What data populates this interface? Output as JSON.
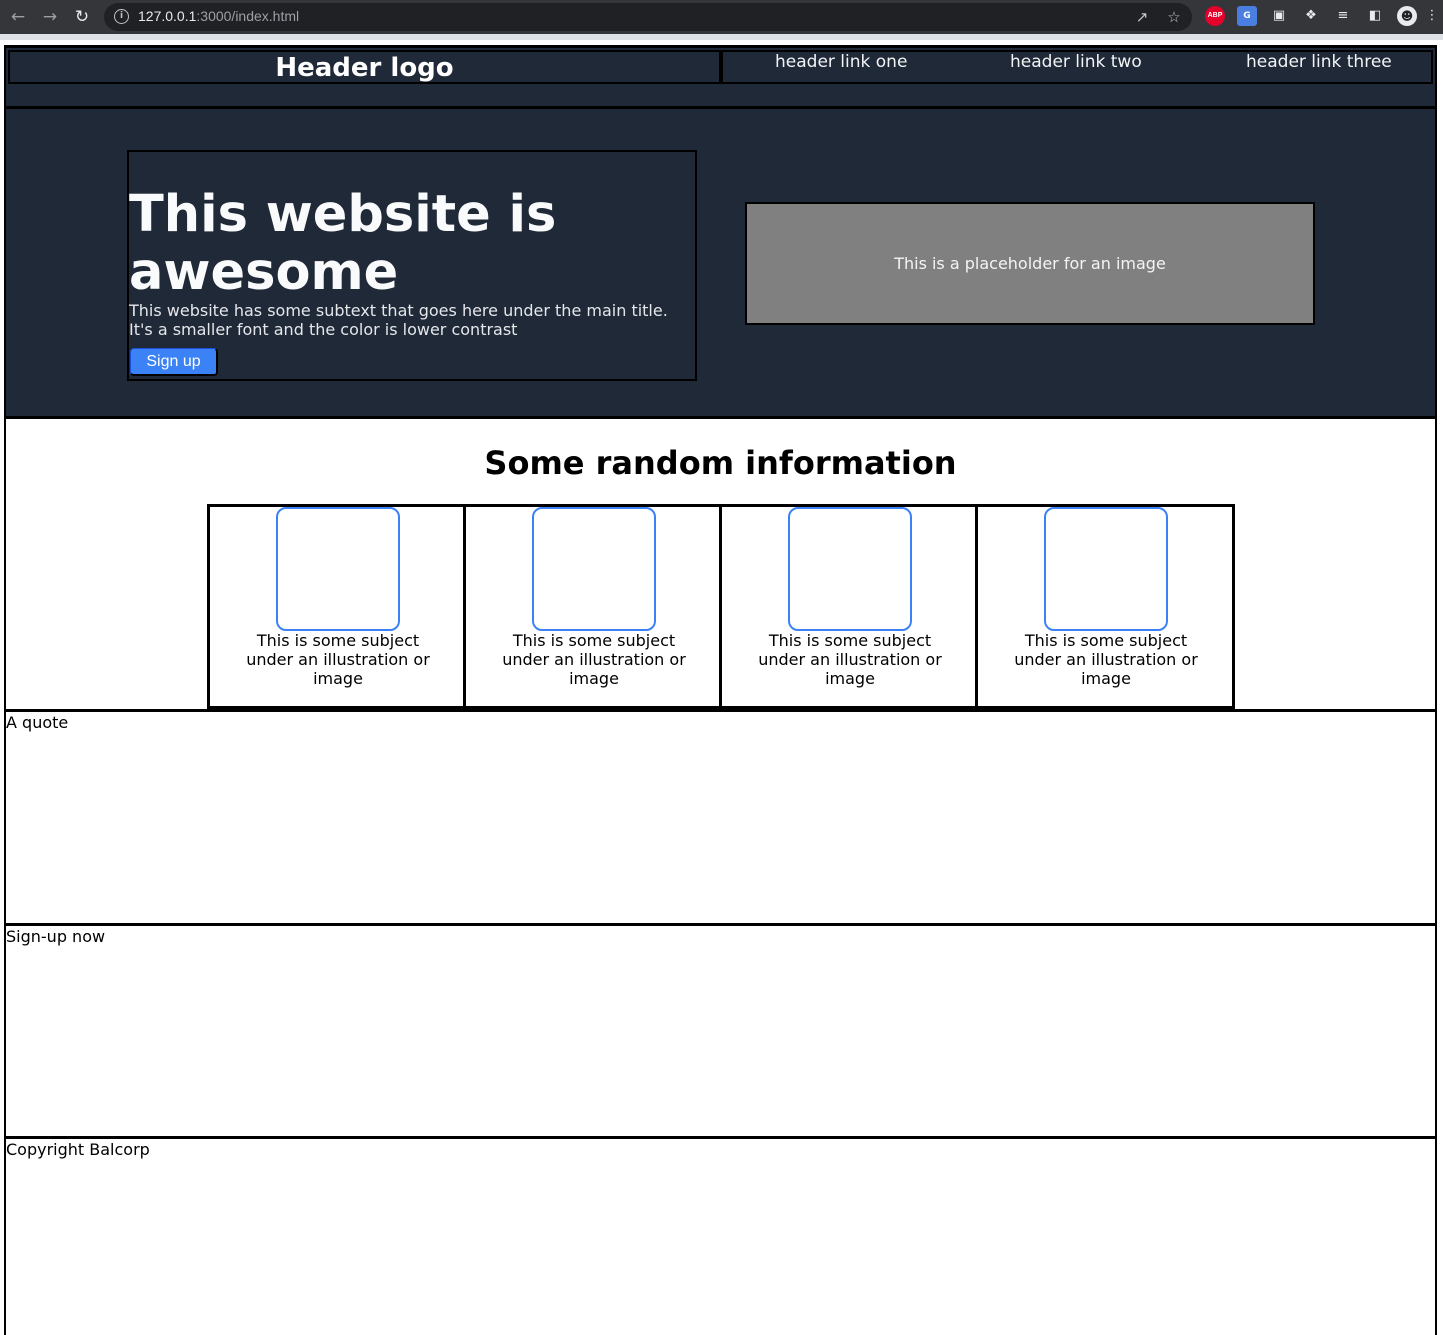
{
  "browser": {
    "url_host": "127.0.0.1",
    "url_rest": ":3000/index.html"
  },
  "header": {
    "logo": "Header logo",
    "links": [
      "header link one",
      "header link two",
      "header link three"
    ]
  },
  "hero": {
    "title": "This website is awesome",
    "subtext": "This website has some subtext that goes here under the main title. It's a smaller font and the color is lower contrast",
    "button_label": "Sign up",
    "image_placeholder": "This is a placeholder for an image"
  },
  "info": {
    "title": "Some random information",
    "cards": [
      {
        "text": "This is some subject under an illustration or image"
      },
      {
        "text": "This is some subject under an illustration or image"
      },
      {
        "text": "This is some subject under an illustration or image"
      },
      {
        "text": "This is some subject under an illustration or image"
      }
    ]
  },
  "quote_section": {
    "label": "A quote"
  },
  "signup_section": {
    "label": "Sign-up now"
  },
  "footer": {
    "label": "Copyright Balcorp"
  },
  "colors": {
    "dark_bg": "#1f2937",
    "accent": "#3b82f6",
    "placeholder": "#808080"
  },
  "icons": [
    "back-icon",
    "forward-icon",
    "reload-icon",
    "info-icon",
    "share-icon",
    "star-icon",
    "adblock-icon",
    "translate-icon",
    "cast-icon",
    "extensions-icon",
    "reading-list-icon",
    "side-panel-icon",
    "profile-avatar"
  ]
}
